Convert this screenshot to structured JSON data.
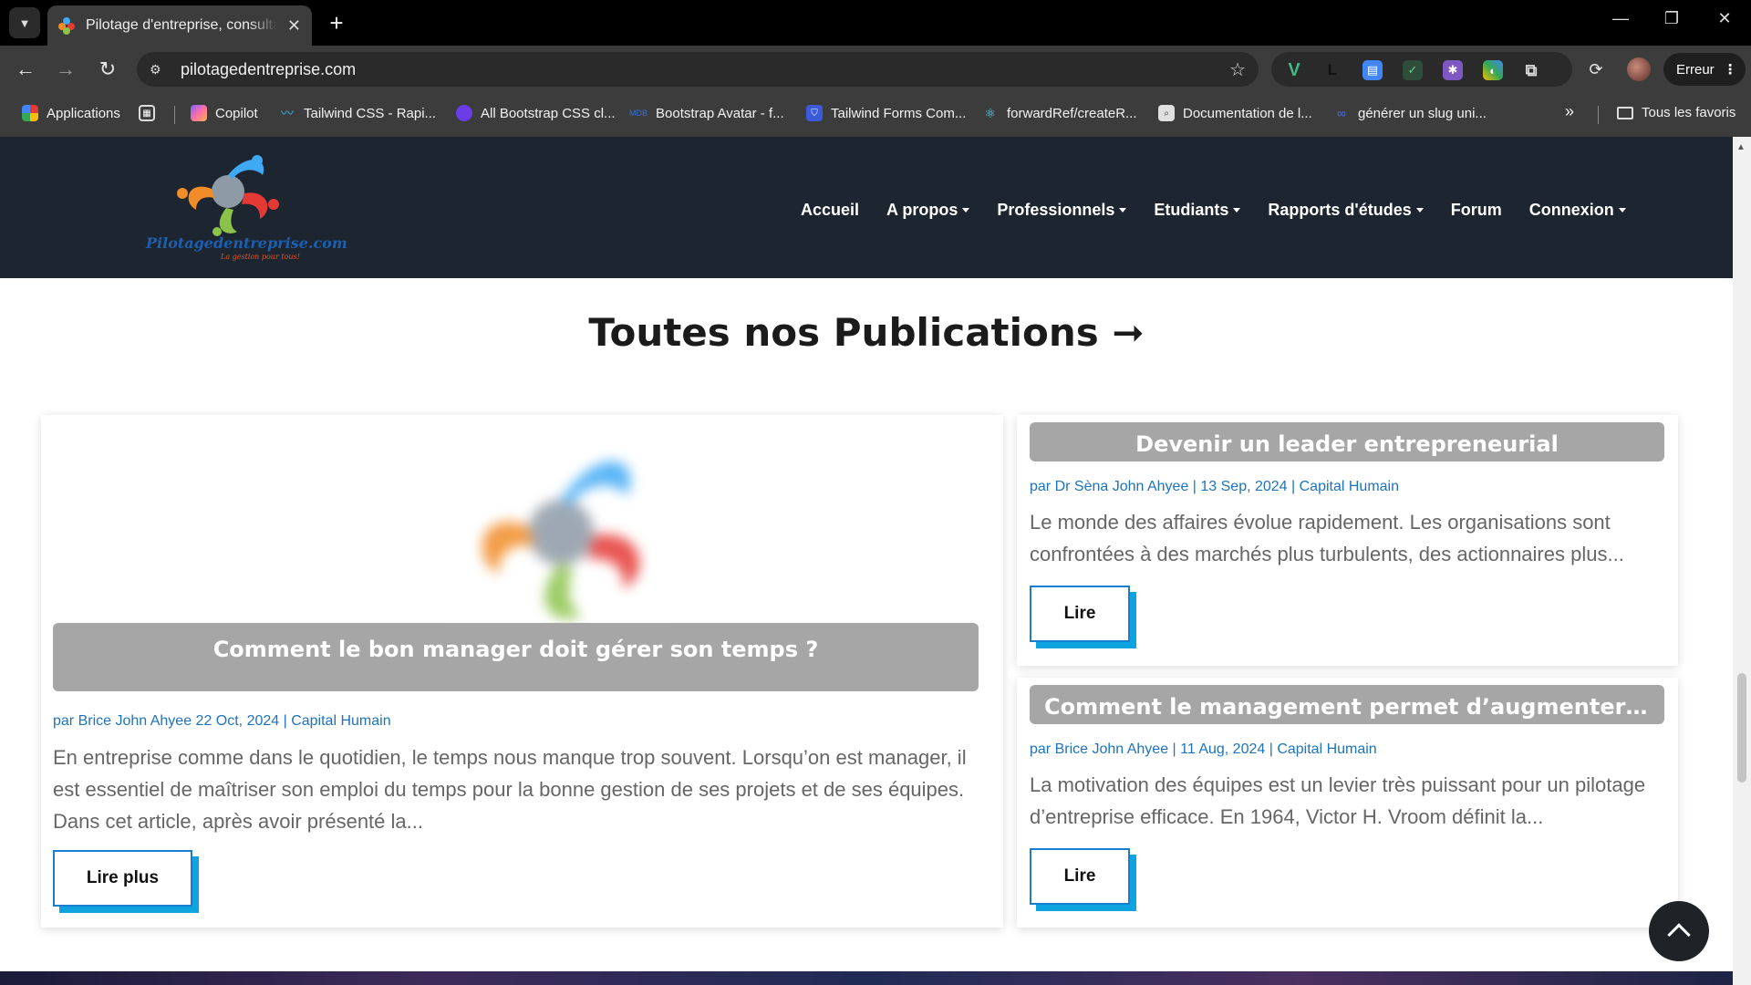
{
  "browser": {
    "tab_title": "Pilotage d'entreprise, consultant",
    "url": "pilotagedentreprise.com",
    "profile_button": "Erreur",
    "bookmarks": [
      {
        "label": "Applications",
        "icon": "apps-grid-icon",
        "color": "#e53935"
      },
      {
        "label": "Copilot",
        "icon": "copilot-icon",
        "color": "#7b61ff"
      },
      {
        "label": "Tailwind CSS - Rapi...",
        "icon": "tailwind-icon",
        "color": "#38bdf8"
      },
      {
        "label": "All Bootstrap CSS cl...",
        "icon": "bootstrap-icon",
        "color": "#6a3de8"
      },
      {
        "label": "Bootstrap Avatar - f...",
        "icon": "mdb-icon",
        "color": "#3b71ca"
      },
      {
        "label": "Tailwind Forms Com...",
        "icon": "tailwind-forms-icon",
        "color": "#3b5bdb"
      },
      {
        "label": "forwardRef/createR...",
        "icon": "react-icon",
        "color": "#61dafb"
      },
      {
        "label": "Documentation de l...",
        "icon": "docs-search-icon",
        "color": "#9e9e9e"
      },
      {
        "label": "générer un slug uni...",
        "icon": "link-icon",
        "color": "#4c6ef5"
      }
    ],
    "all_bookmarks": "Tous les favoris"
  },
  "site": {
    "logo_text": "Pilotagedentreprise.com",
    "logo_tagline": "La gestion pour tous!",
    "nav": [
      {
        "label": "Accueil",
        "dropdown": false
      },
      {
        "label": "A propos",
        "dropdown": true
      },
      {
        "label": "Professionnels",
        "dropdown": true
      },
      {
        "label": "Etudiants",
        "dropdown": true
      },
      {
        "label": "Rapports d'études",
        "dropdown": true
      },
      {
        "label": "Forum",
        "dropdown": false
      },
      {
        "label": "Connexion",
        "dropdown": true
      }
    ]
  },
  "section": {
    "title": "Toutes nos Publications ➞"
  },
  "posts": [
    {
      "title": "Comment le bon manager doit gérer son temps ?",
      "meta": "par Brice John Ahyee 22 Oct, 2024 | Capital Humain",
      "excerpt": "En entreprise comme dans le quotidien, le temps nous manque trop souvent. Lorsqu’on est manager, il est essentiel de maîtriser son emploi du temps pour la bonne gestion de ses projets et de ses équipes. Dans cet article, après avoir présenté la...",
      "button": "Lire plus"
    },
    {
      "title": "Devenir un leader entrepreneurial",
      "meta": "par Dr Sèna John Ahyee | 13 Sep, 2024 | Capital Humain",
      "excerpt": "Le monde des affaires évolue rapidement. Les organisations sont confrontées à des marchés plus turbulents, des actionnaires plus...",
      "button": "Lire"
    },
    {
      "title": "Comment le management permet d’augmenter la...",
      "meta": "par Brice John Ahyee | 11 Aug, 2024 | Capital Humain",
      "excerpt": "La motivation des équipes est un levier très puissant pour un pilotage d’entreprise efficace. En 1964, Victor H. Vroom définit la...",
      "button": "Lire"
    }
  ],
  "colors": {
    "header_bg": "#1d2630",
    "accent_blue": "#1e73be",
    "button_shadow": "#0ea4df",
    "title_bar": "#a6a6a6"
  }
}
